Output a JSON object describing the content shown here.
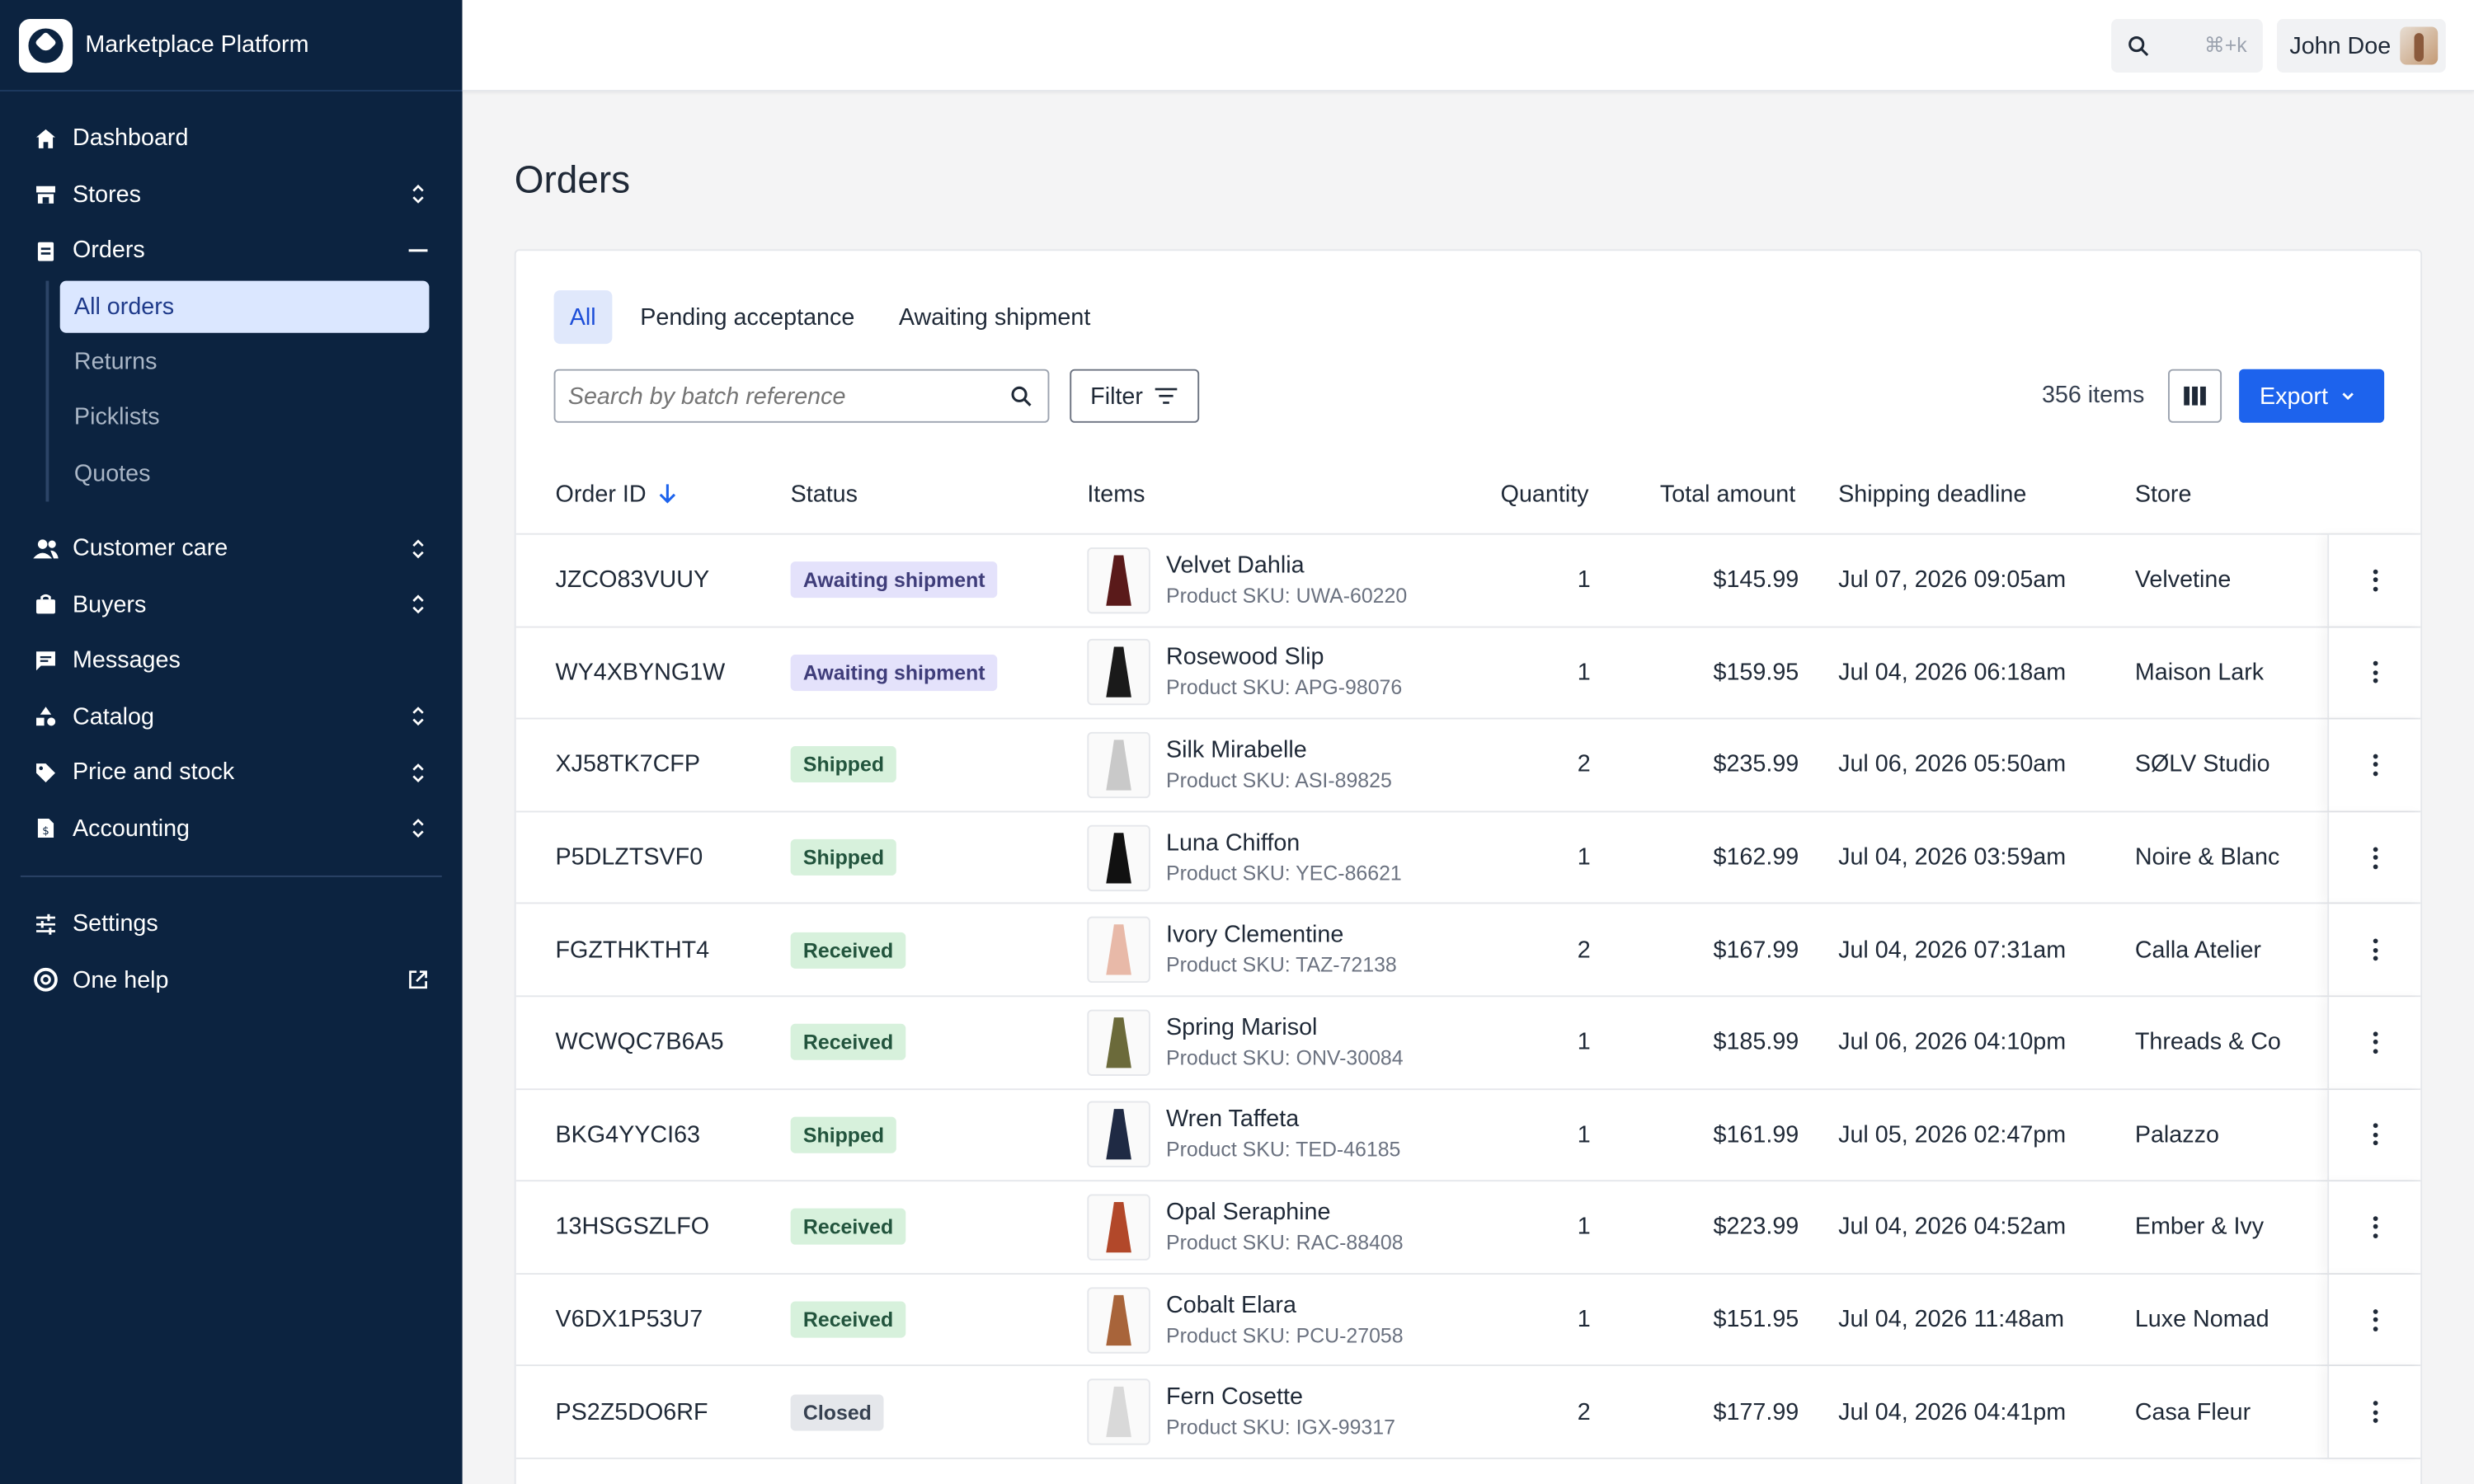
{
  "brand": {
    "name": "Marketplace Platform"
  },
  "nav": {
    "dashboard": "Dashboard",
    "stores": "Stores",
    "orders": "Orders",
    "orders_sub": [
      "All orders",
      "Returns",
      "Picklists",
      "Quotes"
    ],
    "customer_care": "Customer care",
    "buyers": "Buyers",
    "messages": "Messages",
    "catalog": "Catalog",
    "price_stock": "Price and stock",
    "accounting": "Accounting",
    "settings": "Settings",
    "help": "One help"
  },
  "topbar": {
    "shortcut": "⌘+k",
    "user_name": "John Doe"
  },
  "page": {
    "title": "Orders"
  },
  "tabs": [
    "All",
    "Pending acceptance",
    "Awaiting shipment"
  ],
  "toolbar": {
    "search_placeholder": "Search by batch reference",
    "filter_label": "Filter",
    "items_count": "356 items",
    "export_label": "Export"
  },
  "table": {
    "headers": {
      "order_id": "Order ID",
      "status": "Status",
      "items": "Items",
      "quantity": "Quantity",
      "total": "Total amount",
      "deadline": "Shipping deadline",
      "store": "Store"
    },
    "rows": [
      {
        "id": "JZCO83VUUY",
        "status": "Awaiting shipment",
        "item": "Velvet Dahlia",
        "sku": "Product SKU: UWA-60220",
        "qty": "1",
        "total": "$145.99",
        "deadline": "Jul 07, 2026 09:05am",
        "store": "Velvetine"
      },
      {
        "id": "WY4XBYNG1W",
        "status": "Awaiting shipment",
        "item": "Rosewood Slip",
        "sku": "Product SKU: APG-98076",
        "qty": "1",
        "total": "$159.95",
        "deadline": "Jul 04, 2026 06:18am",
        "store": "Maison Lark"
      },
      {
        "id": "XJ58TK7CFP",
        "status": "Shipped",
        "item": "Silk Mirabelle",
        "sku": "Product SKU: ASI-89825",
        "qty": "2",
        "total": "$235.99",
        "deadline": "Jul 06, 2026 05:50am",
        "store": "SØLV Studio"
      },
      {
        "id": "P5DLZTSVF0",
        "status": "Shipped",
        "item": "Luna Chiffon",
        "sku": "Product SKU: YEC-86621",
        "qty": "1",
        "total": "$162.99",
        "deadline": "Jul 04, 2026 03:59am",
        "store": "Noire & Blanc"
      },
      {
        "id": "FGZTHKTHT4",
        "status": "Received",
        "item": "Ivory Clementine",
        "sku": "Product SKU: TAZ-72138",
        "qty": "2",
        "total": "$167.99",
        "deadline": "Jul 04, 2026 07:31am",
        "store": "Calla Atelier"
      },
      {
        "id": "WCWQC7B6A5",
        "status": "Received",
        "item": "Spring Marisol",
        "sku": "Product SKU: ONV-30084",
        "qty": "1",
        "total": "$185.99",
        "deadline": "Jul 06, 2026 04:10pm",
        "store": "Threads & Co"
      },
      {
        "id": "BKG4YYCI63",
        "status": "Shipped",
        "item": "Wren Taffeta",
        "sku": "Product SKU: TED-46185",
        "qty": "1",
        "total": "$161.99",
        "deadline": "Jul 05, 2026 02:47pm",
        "store": "Palazzo"
      },
      {
        "id": "13HSGSZLFO",
        "status": "Received",
        "item": "Opal Seraphine",
        "sku": "Product SKU: RAC-88408",
        "qty": "1",
        "total": "$223.99",
        "deadline": "Jul 04, 2026 04:52am",
        "store": "Ember & Ivy"
      },
      {
        "id": "V6DX1P53U7",
        "status": "Received",
        "item": "Cobalt Elara",
        "sku": "Product SKU: PCU-27058",
        "qty": "1",
        "total": "$151.95",
        "deadline": "Jul 04, 2026 11:48am",
        "store": "Luxe Nomad"
      },
      {
        "id": "PS2Z5DO6RF",
        "status": "Closed",
        "item": "Fern Cosette",
        "sku": "Product SKU: IGX-99317",
        "qty": "2",
        "total": "$177.99",
        "deadline": "Jul 04, 2026 04:41pm",
        "store": "Casa Fleur"
      }
    ],
    "dress_colors": [
      "#5a1a1a",
      "#1a1a1a",
      "#c9c9c9",
      "#111111",
      "#e8b9a8",
      "#6b6a3a",
      "#1f2a44",
      "#b2482a",
      "#a8643a",
      "#d9d9d9"
    ]
  },
  "colors": {
    "sidebar_bg": "#0c2340",
    "accent": "#1d63ed"
  }
}
